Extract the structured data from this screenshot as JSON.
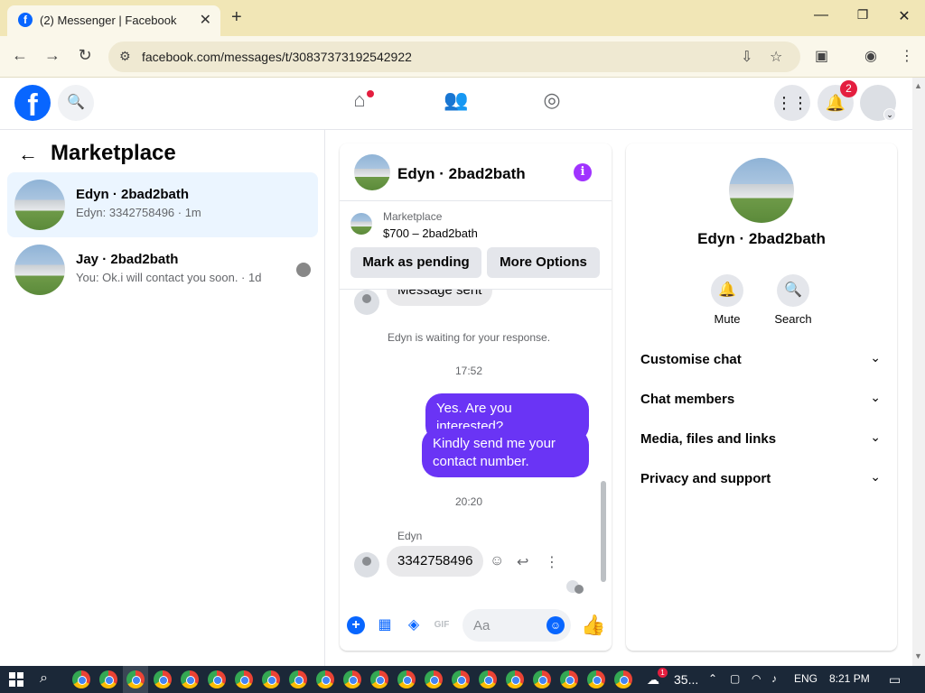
{
  "browser": {
    "tab_title": "(2) Messenger | Facebook",
    "tab_favicon": "f",
    "new_tab_label": "+",
    "url": "facebook.com/messages/t/30837373192542922"
  },
  "facebook": {
    "logo_letter": "f",
    "notification_count": "2",
    "colors": {
      "brand": "#0866ff",
      "message_out": "#6a34f5",
      "badge": "#e41e3f"
    }
  },
  "sidebar": {
    "title": "Marketplace",
    "conversations": [
      {
        "name": "Edyn · 2bad2bath",
        "preview": "Edyn: 3342758496 · 1m",
        "active": true
      },
      {
        "name": "Jay · 2bad2bath",
        "preview": "You: Ok.i will contact you soon. · 1d",
        "active": false
      }
    ]
  },
  "chat": {
    "name": "Edyn · 2bad2bath",
    "marketplace_label": "Marketplace",
    "listing": "$700 – 2bad2bath",
    "mark_pending_label": "Mark as pending",
    "more_options_label": "More Options",
    "messages": {
      "message_sent": "Message sent",
      "waiting": "Edyn is waiting for your response.",
      "time1": "17:52",
      "out1": "Yes. Are you interested?",
      "out2": "Kindly send me your contact number.",
      "time2": "20:20",
      "sender": "Edyn",
      "in1": "3342758496"
    },
    "composer_placeholder": "Aa"
  },
  "info_panel": {
    "name": "Edyn · 2bad2bath",
    "actions": [
      {
        "label": "Mute",
        "icon": "bell-icon"
      },
      {
        "label": "Search",
        "icon": "search-icon"
      }
    ],
    "sections": [
      "Customise chat",
      "Chat members",
      "Media, files and links",
      "Privacy and support"
    ]
  },
  "taskbar": {
    "weather": "35...",
    "weather_badge": "1",
    "language": "ENG",
    "time": "8:21 PM"
  }
}
